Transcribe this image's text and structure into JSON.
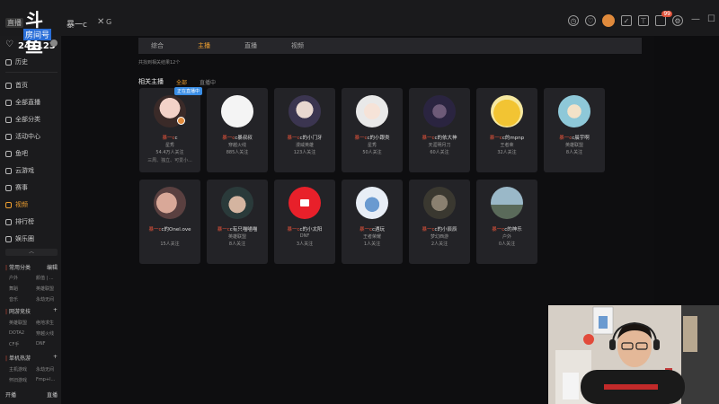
{
  "brand": {
    "logo_text": "斗鱼",
    "logo_sub": "房间号",
    "logo_small": "直播",
    "room_id": "241123"
  },
  "tabs": {
    "title": "暴一c",
    "close": "✕",
    "extra": "G"
  },
  "topbar": {
    "notification_count": "99"
  },
  "sidebar": {
    "items": [
      {
        "label": "历史",
        "active": false
      },
      {
        "label": "首页",
        "active": false
      },
      {
        "label": "全部直播",
        "active": false
      },
      {
        "label": "全部分类",
        "active": false
      },
      {
        "label": "活动中心",
        "active": false
      },
      {
        "label": "鱼吧",
        "active": false
      },
      {
        "label": "云游戏",
        "active": false
      },
      {
        "label": "赛事",
        "active": false
      },
      {
        "label": "视频",
        "active": true
      },
      {
        "label": "排行榜",
        "active": false
      },
      {
        "label": "娱乐圈",
        "active": false
      }
    ],
    "groups": [
      {
        "title": "常用分类",
        "action": "编辑",
        "entries": [
          "户外",
          "颜值 | ...",
          "舞蹈",
          "英雄联盟",
          "音乐",
          "永劫无间"
        ]
      },
      {
        "title": "网游竞技",
        "action": "+",
        "entries": [
          "英雄联盟",
          "绝地求生",
          "DOTA2",
          "穿越火线",
          "CF手",
          "DNF"
        ]
      },
      {
        "title": "单机热游",
        "action": "+",
        "entries": [
          "主机游戏",
          "永劫无间",
          "怀旧游戏",
          "Fmp+l..."
        ]
      }
    ],
    "bottom": {
      "left": "开播",
      "right": "直播"
    }
  },
  "main": {
    "subtabs": [
      {
        "label": "综合",
        "active": false
      },
      {
        "label": "主播",
        "active": true
      },
      {
        "label": "直播",
        "active": false
      },
      {
        "label": "视频",
        "active": false
      }
    ],
    "result_text": "共找到相关结果12个",
    "section": {
      "title": "相关主播",
      "filter_all": "全部",
      "filter_live": "直播中"
    },
    "live_badge": "正在直播中",
    "cards": [
      {
        "name_hl": "暴一c",
        "name_rest": "c",
        "tag": "星秀",
        "fans": "54.4万人关注",
        "extra": "三周、独立、可爱小..."
      },
      {
        "name_hl": "暴一c",
        "name_rest": "c暴叔叔",
        "tag": "穿越火线",
        "fans": "885人关注",
        "extra": ""
      },
      {
        "name_hl": "暴一c",
        "name_rest": "c的小门牙",
        "tag": "漫威英雄",
        "fans": "123人关注",
        "extra": ""
      },
      {
        "name_hl": "暴一c",
        "name_rest": "c的小跟类",
        "tag": "星秀",
        "fans": "50人关注",
        "extra": ""
      },
      {
        "name_hl": "暴一c",
        "name_rest": "c的依大神",
        "tag": "天涯明月刀",
        "fans": "60人关注",
        "extra": ""
      },
      {
        "name_hl": "暴一c",
        "name_rest": "c的mpnp",
        "tag": "王者荣",
        "fans": "32人关注",
        "extra": ""
      },
      {
        "name_hl": "暴一c",
        "name_rest": "c晨宇啊",
        "tag": "英雄联盟",
        "fans": "8人关注",
        "extra": ""
      },
      {
        "name_hl": "暴一c",
        "name_rest": "c的Onel.ove",
        "tag": "",
        "fans": "15人关注",
        "extra": ""
      },
      {
        "name_hl": "暴一c",
        "name_rest": "c有只喵喵喵",
        "tag": "英雄联盟",
        "fans": "8人关注",
        "extra": ""
      },
      {
        "name_hl": "暴一c",
        "name_rest": "c的小太阳",
        "tag": "DNF",
        "fans": "3人关注",
        "extra": ""
      },
      {
        "name_hl": "暴一c",
        "name_rest": "c遇玩",
        "tag": "王者荣耀",
        "fans": "1人关注",
        "extra": ""
      },
      {
        "name_hl": "暴一c",
        "name_rest": "c的小辰辰",
        "tag": "梦幻西游",
        "fans": "2人关注",
        "extra": ""
      },
      {
        "name_hl": "暴一c",
        "name_rest": "c的神乐",
        "tag": "户外",
        "fans": "0人关注",
        "extra": ""
      }
    ]
  },
  "colors": {
    "accent": "#f0a030",
    "highlight": "#e0523a",
    "card_bg": "#232327",
    "panel_bg": "#0e0e10"
  }
}
